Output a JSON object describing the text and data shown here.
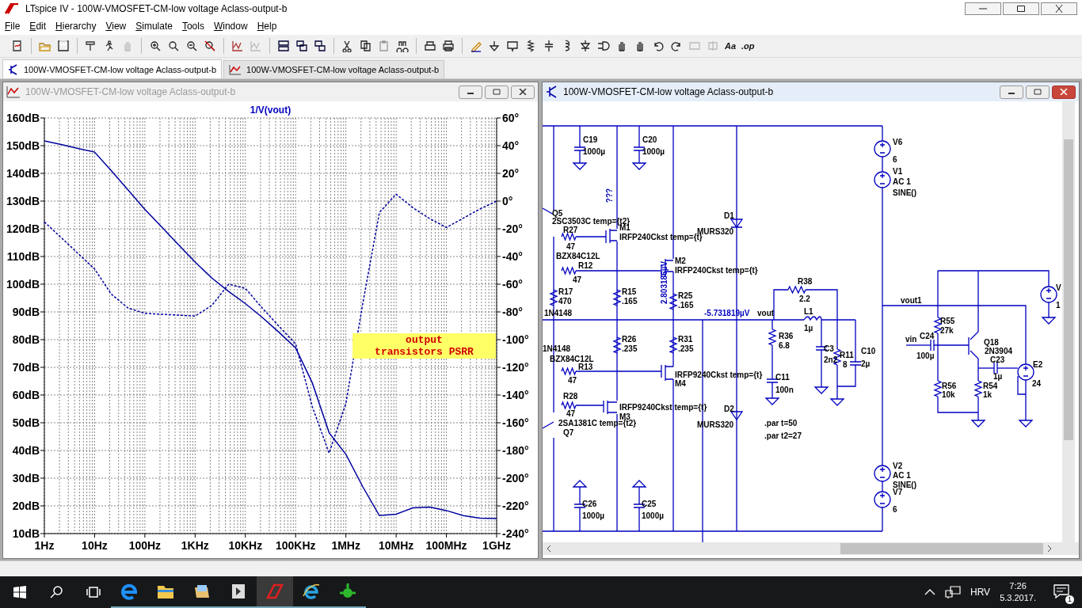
{
  "app_window": {
    "title": "LTspice IV - 100W-VMOSFET-CM-low voltage Aclass-output-b"
  },
  "menu": [
    "File",
    "Edit",
    "Hierarchy",
    "View",
    "Simulate",
    "Tools",
    "Window",
    "Help"
  ],
  "toolbar_glyphs": [
    "Aa",
    ".op"
  ],
  "tabs": [
    {
      "label": "100W-VMOSFET-CM-low voltage Aclass-output-b",
      "kind": "schematic",
      "selected": true
    },
    {
      "label": "100W-VMOSFET-CM-low voltage Aclass-output-b",
      "kind": "plot",
      "selected": false
    }
  ],
  "plot_window": {
    "title": "100W-VMOSFET-CM-low voltage Aclass-output-b",
    "active": false,
    "chart_data": {
      "type": "line",
      "title": "1/V(vout)",
      "grid": true,
      "categories": [
        "1Hz",
        null,
        null,
        "10Hz",
        null,
        null,
        "100Hz",
        null,
        null,
        "1KHz",
        null,
        null,
        "10KHz",
        null,
        null,
        "100KHz",
        null,
        null,
        "1MHz",
        null,
        null,
        "10MHz",
        null,
        null,
        "100MHz",
        null,
        null,
        "1GHz"
      ],
      "series": [
        {
          "color": "#0000a0",
          "values": [
            151.7,
            150.4,
            149,
            147.7,
            140.9,
            134,
            127,
            120.7,
            114.3,
            108,
            102.2,
            97.4,
            93,
            88.1,
            82.7,
            77,
            64.3,
            46.4,
            38.6,
            27,
            16.5,
            17,
            19.3,
            19.6,
            18.3,
            16.5,
            15.6,
            15.4
          ]
        },
        {
          "color": "#0000a0",
          "axis": "y2",
          "line_style": "dashed",
          "values": [
            -15,
            -26.3,
            -37.7,
            -49,
            -67.2,
            -77.2,
            -81,
            -81.7,
            -82.3,
            -83,
            -75.3,
            -60,
            -63,
            -77,
            -90.3,
            -103,
            -148.6,
            -181.8,
            -146,
            -74.6,
            -8.2,
            5,
            -4.8,
            -12.6,
            -19,
            -12.4,
            -5.7,
            0
          ]
        }
      ],
      "ylim": [
        10,
        160
      ],
      "y2lim": [
        -240,
        60
      ],
      "yticks": [
        {
          "value": 160,
          "label": "160dB"
        },
        {
          "value": 150,
          "label": "150dB"
        },
        {
          "value": 140,
          "label": "140dB"
        },
        {
          "value": 130,
          "label": "130dB"
        },
        {
          "value": 120,
          "label": "120dB"
        },
        {
          "value": 110,
          "label": "110dB"
        },
        {
          "value": 100,
          "label": "100dB"
        },
        {
          "value": 90,
          "label": "90dB"
        },
        {
          "value": 80,
          "label": "80dB"
        },
        {
          "value": 70,
          "label": "70dB"
        },
        {
          "value": 60,
          "label": "60dB"
        },
        {
          "value": 50,
          "label": "50dB"
        },
        {
          "value": 40,
          "label": "40dB"
        },
        {
          "value": 30,
          "label": "30dB"
        },
        {
          "value": 20,
          "label": "20dB"
        },
        {
          "value": 10,
          "label": "10dB"
        }
      ],
      "y2ticks": [
        {
          "value": 60,
          "label": "60°"
        },
        {
          "value": 40,
          "label": "40°"
        },
        {
          "value": 20,
          "label": "20°"
        },
        {
          "value": 0,
          "label": "0°"
        },
        {
          "value": -20,
          "label": "-20°"
        },
        {
          "value": -40,
          "label": "-40°"
        },
        {
          "value": -60,
          "label": "-60°"
        },
        {
          "value": -80,
          "label": "-80°"
        },
        {
          "value": -100,
          "label": "-100°"
        },
        {
          "value": -120,
          "label": "-120°"
        },
        {
          "value": -140,
          "label": "-140°"
        },
        {
          "value": -160,
          "label": "-160°"
        },
        {
          "value": -180,
          "label": "-180°"
        },
        {
          "value": -200,
          "label": "-200°"
        },
        {
          "value": -220,
          "label": "-220°"
        },
        {
          "value": -240,
          "label": "-240°"
        }
      ],
      "annotations": [
        {
          "text": "output\ntransistors PSRR"
        }
      ]
    }
  },
  "schematic_window": {
    "title": "100W-VMOSFET-CM-low voltage Aclass-output-b",
    "active": true,
    "labels": [
      {
        "text": "C19",
        "kind": "label"
      },
      {
        "text": "1000µ",
        "kind": "label"
      },
      {
        "text": "C20",
        "kind": "label"
      },
      {
        "text": "1000µ",
        "kind": "label"
      },
      {
        "text": "V6",
        "kind": "label"
      },
      {
        "text": "6",
        "kind": "label"
      },
      {
        "text": "V1",
        "kind": "label"
      },
      {
        "text": "AC 1",
        "kind": "label"
      },
      {
        "text": "SINE()",
        "kind": "label"
      },
      {
        "text": "???",
        "kind": "probe"
      },
      {
        "text": "Q5",
        "kind": "label"
      },
      {
        "text": "2SC3503C temp={t2}",
        "kind": "label"
      },
      {
        "text": "R27",
        "kind": "label"
      },
      {
        "text": "47",
        "kind": "label"
      },
      {
        "text": "M1",
        "kind": "label"
      },
      {
        "text": "IRFP240Ckst temp={t}",
        "kind": "label"
      },
      {
        "text": "D1",
        "kind": "label"
      },
      {
        "text": "MURS320",
        "kind": "label"
      },
      {
        "text": "BZX84C12L",
        "kind": "label"
      },
      {
        "text": "R12",
        "kind": "label"
      },
      {
        "text": "47",
        "kind": "label"
      },
      {
        "text": "M2",
        "kind": "label"
      },
      {
        "text": "IRFP240Ckst temp={t}",
        "kind": "label"
      },
      {
        "text": "R17",
        "kind": "label"
      },
      {
        "text": "470",
        "kind": "label"
      },
      {
        "text": "R15",
        "kind": "label"
      },
      {
        "text": ".165",
        "kind": "label"
      },
      {
        "text": "2.803186µV",
        "kind": "probe"
      },
      {
        "text": "R25",
        "kind": "label"
      },
      {
        "text": ".165",
        "kind": "label"
      },
      {
        "text": "1N4148",
        "kind": "label"
      },
      {
        "text": "-5.731819µV",
        "kind": "probe"
      },
      {
        "text": "vout",
        "kind": "label"
      },
      {
        "text": "R38",
        "kind": "label"
      },
      {
        "text": "2.2",
        "kind": "label"
      },
      {
        "text": "L1",
        "kind": "label"
      },
      {
        "text": "1µ",
        "kind": "label"
      },
      {
        "text": "vout1",
        "kind": "label"
      },
      {
        "text": "V",
        "kind": "label"
      },
      {
        "text": "1",
        "kind": "label"
      },
      {
        "text": "R55",
        "kind": "label"
      },
      {
        "text": "27k",
        "kind": "label"
      },
      {
        "text": "vin",
        "kind": "label"
      },
      {
        "text": "C24",
        "kind": "label"
      },
      {
        "text": "100µ",
        "kind": "label"
      },
      {
        "text": "Q18",
        "kind": "label"
      },
      {
        "text": "2N3904",
        "kind": "label"
      },
      {
        "text": "C23",
        "kind": "label"
      },
      {
        "text": "1µ",
        "kind": "label"
      },
      {
        "text": "R56",
        "kind": "label"
      },
      {
        "text": "10k",
        "kind": "label"
      },
      {
        "text": "R54",
        "kind": "label"
      },
      {
        "text": "1k",
        "kind": "label"
      },
      {
        "text": "E2",
        "kind": "label"
      },
      {
        "text": "24",
        "kind": "label"
      },
      {
        "text": "1N4148",
        "kind": "label"
      },
      {
        "text": "BZX84C12L",
        "kind": "label"
      },
      {
        "text": "R13",
        "kind": "label"
      },
      {
        "text": "47",
        "kind": "label"
      },
      {
        "text": "R26",
        "kind": "label"
      },
      {
        "text": ".235",
        "kind": "label"
      },
      {
        "text": "R31",
        "kind": "label"
      },
      {
        "text": ".235",
        "kind": "label"
      },
      {
        "text": "R36",
        "kind": "label"
      },
      {
        "text": "6.8",
        "kind": "label"
      },
      {
        "text": "C3",
        "kind": "label"
      },
      {
        "text": "2n2",
        "kind": "label"
      },
      {
        "text": "R11",
        "kind": "label"
      },
      {
        "text": "8",
        "kind": "label"
      },
      {
        "text": "C10",
        "kind": "label"
      },
      {
        "text": "2µ",
        "kind": "label"
      },
      {
        "text": "IRFP9240Ckst temp={t}",
        "kind": "label"
      },
      {
        "text": "M4",
        "kind": "label"
      },
      {
        "text": "C11",
        "kind": "label"
      },
      {
        "text": "100n",
        "kind": "label"
      },
      {
        "text": "R28",
        "kind": "label"
      },
      {
        "text": "47",
        "kind": "label"
      },
      {
        "text": "IRFP9240Ckst temp={t}",
        "kind": "label"
      },
      {
        "text": "D2",
        "kind": "label"
      },
      {
        "text": "M3",
        "kind": "label"
      },
      {
        "text": "2SA1381C temp={t2}",
        "kind": "label"
      },
      {
        "text": "MURS320",
        "kind": "label"
      },
      {
        "text": ".par t=50",
        "kind": "label"
      },
      {
        "text": "Q7",
        "kind": "label"
      },
      {
        "text": ".par t2=27",
        "kind": "label"
      },
      {
        "text": "V2",
        "kind": "label"
      },
      {
        "text": "AC 1",
        "kind": "label"
      },
      {
        "text": "SINE()",
        "kind": "label"
      },
      {
        "text": "V7",
        "kind": "label"
      },
      {
        "text": "6",
        "kind": "label"
      },
      {
        "text": "C26",
        "kind": "label"
      },
      {
        "text": "1000µ",
        "kind": "label"
      },
      {
        "text": "C25",
        "kind": "label"
      },
      {
        "text": "1000µ",
        "kind": "label"
      }
    ]
  },
  "taskbar": {
    "language": "HRV",
    "time": "7:26",
    "date": "5.3.2017.",
    "notifications": "1"
  }
}
